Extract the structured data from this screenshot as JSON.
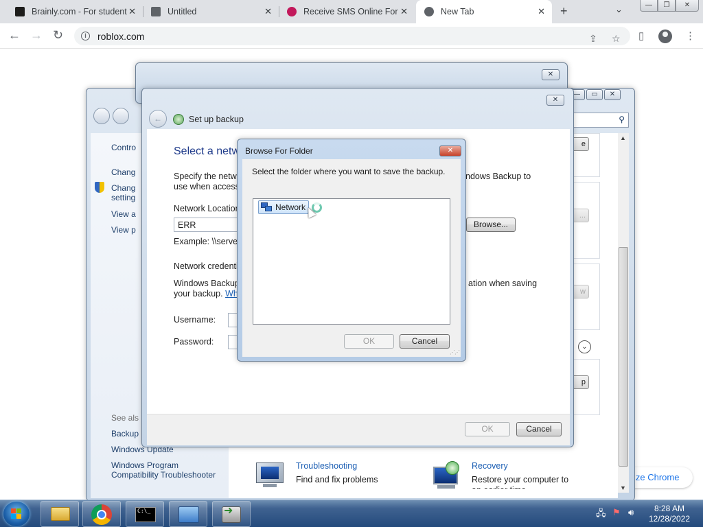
{
  "browser": {
    "tabs": [
      {
        "title": "Brainly.com - For student",
        "favicon_color": "#1d1d1b",
        "active": false
      },
      {
        "title": "Untitled",
        "favicon_color": "#5f6368",
        "active": false
      },
      {
        "title": "Receive SMS Online For",
        "favicon_color": "#c2185b",
        "active": false
      },
      {
        "title": "New Tab",
        "favicon_color": "#5f6368",
        "active": true
      }
    ],
    "url": "roblox.com",
    "customize_label": "ize Chrome"
  },
  "control_panel": {
    "left_links": [
      "Contro",
      "Chang",
      "Chang\nsetting",
      "View a",
      "View p"
    ],
    "see_also": "See als",
    "see_also_links": [
      "Backup",
      "Windows Update",
      "Windows Program\nCompatibility Troubleshooter"
    ],
    "right_buttons": [
      "e",
      "...",
      "w",
      "p"
    ],
    "troubleshooting": {
      "title": "Troubleshooting",
      "subtitle": "Find and fix problems"
    },
    "recovery": {
      "title": "Recovery",
      "subtitle": "Restore your computer to\nan earlier time"
    }
  },
  "setup_backup": {
    "window_title": "Set up backup",
    "heading": "Select a netw",
    "description_1": "Specify the netwo",
    "description_1_end": "ndows Backup to",
    "description_2": "use when accessin",
    "network_location_label": "Network Location",
    "network_location_value": "ERR",
    "browse_label": "Browse...",
    "example_label": "Example: \\\\server\\",
    "credentials_label": "Network credenti",
    "credentials_text_1": "Windows Backup",
    "credentials_text_1_end": "ation when saving",
    "credentials_text_2": "your backup.",
    "credentials_link": "Whi",
    "username_label": "Username:",
    "password_label": "Password:",
    "ok_label": "OK",
    "cancel_label": "Cancel"
  },
  "browse_dialog": {
    "title": "Browse For Folder",
    "instruction": "Select the folder where you want to save the backup.",
    "tree_items": [
      "Network"
    ],
    "ok_label": "OK",
    "cancel_label": "Cancel",
    "close_label": "✕"
  },
  "taskbar": {
    "time": "8:28 AM",
    "date": "12/28/2022"
  }
}
